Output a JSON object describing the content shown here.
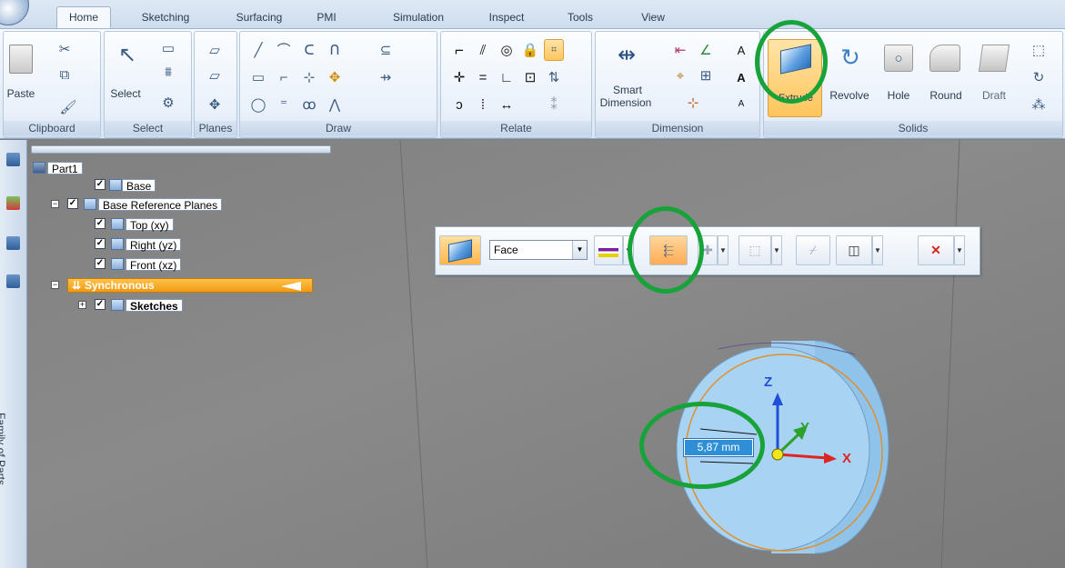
{
  "ribbon": {
    "tabs": [
      "Home",
      "Sketching",
      "Surfacing",
      "PMI",
      "Simulation",
      "Inspect",
      "Tools",
      "View"
    ],
    "active_tab": "Home",
    "groups": {
      "clipboard": {
        "label": "Clipboard",
        "paste_label": "Paste"
      },
      "select": {
        "label": "Select",
        "select_label": "Select"
      },
      "planes": {
        "label": "Planes"
      },
      "draw": {
        "label": "Draw"
      },
      "relate": {
        "label": "Relate"
      },
      "dimension": {
        "label": "Dimension",
        "smart_dimension_label_1": "Smart",
        "smart_dimension_label_2": "Dimension"
      },
      "solids": {
        "label": "Solids",
        "extrude_label": "Extrude",
        "revolve_label": "Revolve",
        "hole_label": "Hole",
        "round_label": "Round",
        "draft_label": "Draft"
      }
    }
  },
  "tree": {
    "part": "Part1",
    "base": "Base",
    "base_ref_planes": "Base Reference Planes",
    "top_plane": "Top (xy)",
    "right_plane": "Right (yz)",
    "front_plane": "Front (xz)",
    "synchronous": "Synchronous",
    "sketches": "Sketches"
  },
  "sidebar": {
    "vertical_label": "Family of Parts"
  },
  "command_bar": {
    "select_value": "Face"
  },
  "viewport": {
    "dimension_value": "5,87 mm",
    "axis_x": "X",
    "axis_y": "Y",
    "axis_z": "Z"
  },
  "colors": {
    "highlight_circle": "#17a23a",
    "extrude_active": "#ffc55c",
    "synchronous_bar": "#f4a01c",
    "part_body": "#a9d3f2"
  }
}
